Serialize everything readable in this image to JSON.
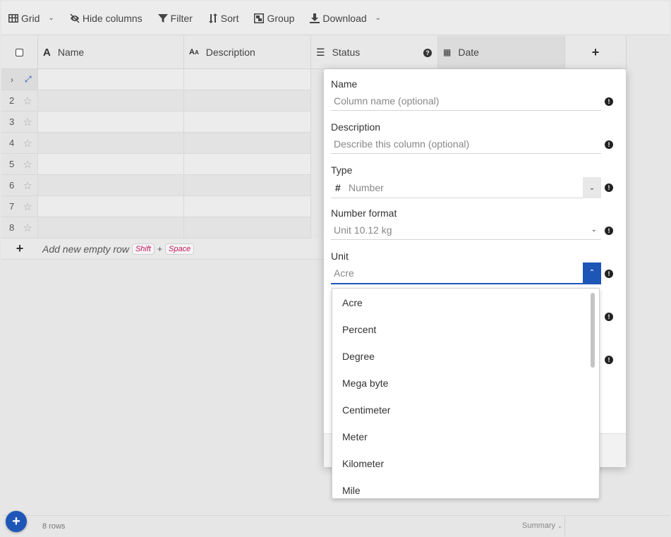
{
  "toolbar": {
    "grid_label": "Grid",
    "hide_columns_label": "Hide columns",
    "filter_label": "Filter",
    "sort_label": "Sort",
    "group_label": "Group",
    "download_label": "Download"
  },
  "grid": {
    "columns": [
      {
        "label": "Name"
      },
      {
        "label": "Description"
      },
      {
        "label": "Status"
      },
      {
        "label": "Date"
      }
    ],
    "row_numbers": [
      "2",
      "3",
      "4",
      "5",
      "6",
      "7",
      "8"
    ],
    "add_row_text": "Add new empty row",
    "shortcut_key1": "Shift",
    "shortcut_plus": "+",
    "shortcut_key2": "Space"
  },
  "footer": {
    "row_count": "8 rows",
    "summary_label": "Summary"
  },
  "panel": {
    "name_label": "Name",
    "name_placeholder": "Column name (optional)",
    "description_label": "Description",
    "description_placeholder": "Describe this column (optional)",
    "type_label": "Type",
    "type_symbol": "#",
    "type_value": "Number",
    "number_format_label": "Number format",
    "number_format_value": "Unit 10.12 kg",
    "unit_label": "Unit",
    "unit_value": "Acre"
  },
  "unit_options": [
    "Acre",
    "Percent",
    "Degree",
    "Mega byte",
    "Centimeter",
    "Meter",
    "Kilometer",
    "Mile"
  ],
  "colors": {
    "accent": "#1e56b8",
    "shortcut": "#c2185b"
  }
}
